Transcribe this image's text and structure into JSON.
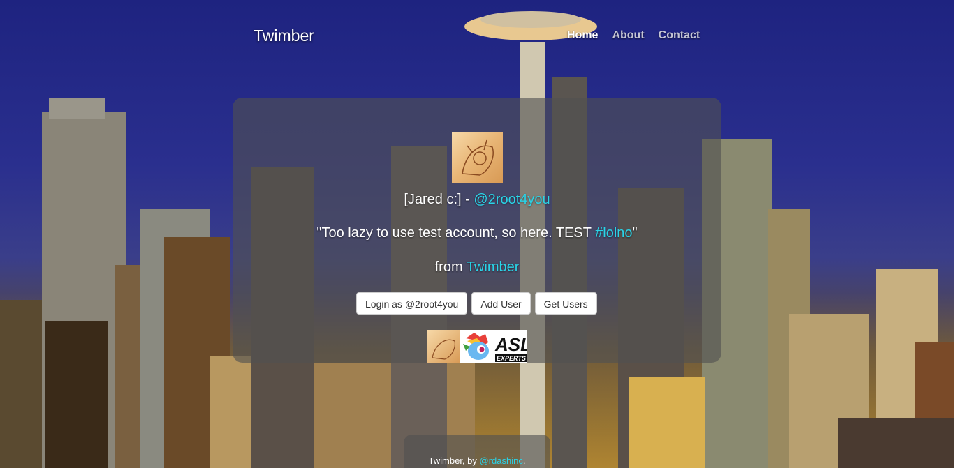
{
  "navbar": {
    "brand": "Twimber",
    "links": [
      {
        "label": "Home",
        "active": true
      },
      {
        "label": "About",
        "active": false
      },
      {
        "label": "Contact",
        "active": false
      }
    ]
  },
  "tweet": {
    "name_prefix": "[Jared c:] - ",
    "handle": "@2root4you",
    "text_prefix": "\"Too lazy to use test account, so here. TEST ",
    "hashtag": "#lolno",
    "text_suffix": "\"",
    "from_prefix": "from ",
    "source": "Twimber"
  },
  "buttons": {
    "login": "Login as @2root4you",
    "add_user": "Add User",
    "get_users": "Get Users"
  },
  "badges": {
    "asl_label": "ASL",
    "asl_sub": "EXPERTS"
  },
  "footer": {
    "prefix": "Twimber, by ",
    "author": "@rdashinc",
    "suffix": "."
  },
  "colors": {
    "link": "#2ad4e8",
    "card": "rgba(80,80,80,0.62)"
  }
}
